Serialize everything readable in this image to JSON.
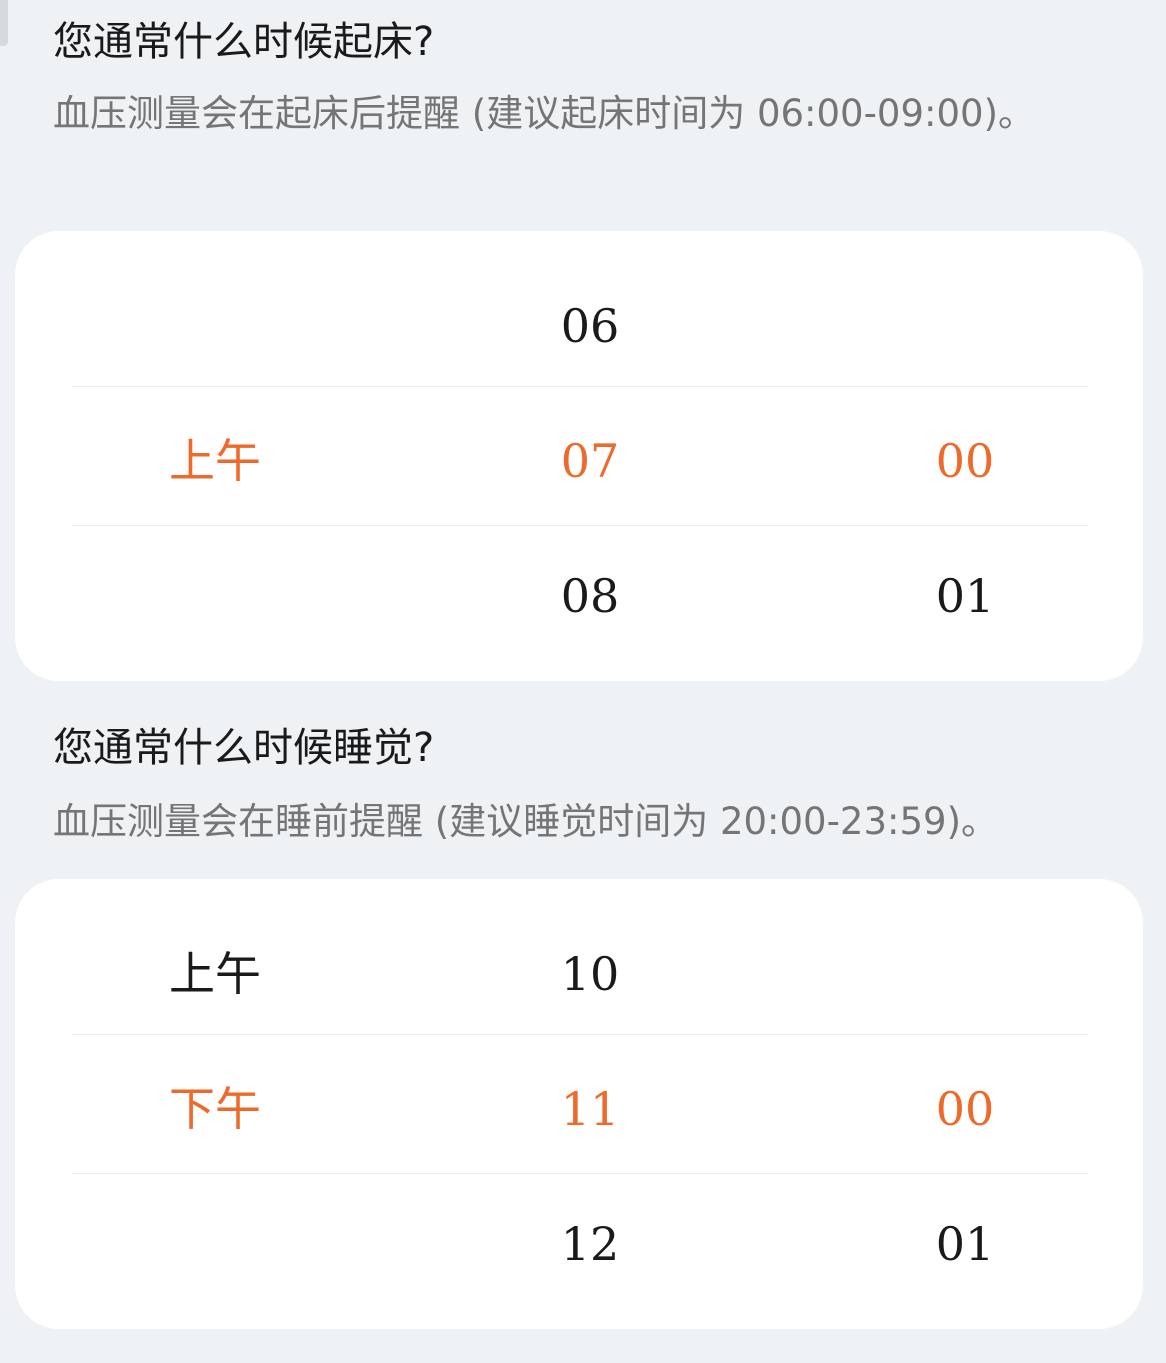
{
  "wake": {
    "title": "您通常什么时候起床?",
    "description": "血压测量会在起床后提醒 (建议起床时间为 06:00-09:00)。",
    "picker": {
      "period": {
        "prev": "",
        "selected": "上午",
        "next": ""
      },
      "hour": {
        "prev": "06",
        "selected": "07",
        "next": "08"
      },
      "minute": {
        "prev": "",
        "selected": "00",
        "next": "01"
      }
    }
  },
  "sleep": {
    "title": "您通常什么时候睡觉?",
    "description": "血压测量会在睡前提醒 (建议睡觉时间为 20:00-23:59)。",
    "picker": {
      "period": {
        "prev": "上午",
        "selected": "下午",
        "next": ""
      },
      "hour": {
        "prev": "10",
        "selected": "11",
        "next": "12"
      },
      "minute": {
        "prev": "",
        "selected": "00",
        "next": "01"
      }
    }
  },
  "colors": {
    "accent": "#ee6a2a",
    "background": "#eff2f5",
    "card": "#ffffff",
    "title_text": "#1a1a1a",
    "secondary_text": "#757575"
  }
}
